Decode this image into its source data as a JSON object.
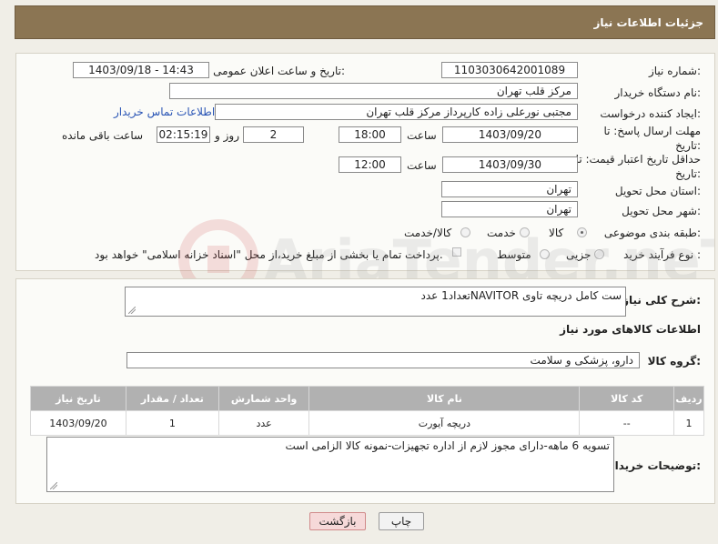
{
  "header": {
    "title": "جزئیات اطلاعات نیاز"
  },
  "form": {
    "need_number_label": "شماره نیاز:",
    "need_number": "1103030642001089",
    "announce_label": "تاریخ و ساعت اعلان عمومی:",
    "announce_value": "1403/09/18 - 14:43",
    "buyer_org_label": "نام دستگاه خریدار:",
    "buyer_org": "مرکز قلب تهران",
    "creator_label": "ایجاد کننده درخواست:",
    "creator": "مجتبی نورعلی زاده کارپرداز مرکز قلب تهران",
    "contact_link": "اطلاعات تماس خریدار",
    "reply_deadline_label": "مهلت ارسال پاسخ: تا تاریخ:",
    "reply_date": "1403/09/20",
    "time_label": "ساعت",
    "reply_time": "18:00",
    "days_value": "2",
    "days_label": "روز و",
    "remaining_time": "02:15:19",
    "remaining_label": "ساعت باقی مانده",
    "price_validity_label": "حداقل تاریخ اعتبار قیمت: تا تاریخ:",
    "price_date": "1403/09/30",
    "price_time": "12:00",
    "province_label": "استان محل تحویل:",
    "province": "تهران",
    "city_label": "شهر محل تحویل:",
    "city": "تهران",
    "category_label": "طبقه بندی موضوعی:",
    "category_options": [
      "کالا",
      "خدمت",
      "کالا/خدمت"
    ],
    "purchase_type_label": "نوع فرآیند خرید :",
    "purchase_options": [
      "جزیی",
      "متوسط"
    ],
    "payment_note": "پرداخت تمام یا بخشی از مبلغ خرید،از محل \"اسناد خزانه اسلامی\" خواهد بود."
  },
  "description": {
    "label": "شرح کلی نیاز:",
    "text": "ست کامل دریچه تاوی NAVITORتعداد1 عدد"
  },
  "goods_info": {
    "title": "اطلاعات کالاهای مورد نیاز",
    "group_label": "گروه کالا:",
    "group_value": "دارو، پزشکی و سلامت"
  },
  "items_table": {
    "columns": [
      "ردیف",
      "کد کالا",
      "نام کالا",
      "واحد شمارش",
      "تعداد / مقدار",
      "تاریخ نیاز"
    ],
    "rows": [
      [
        "1",
        "--",
        "دریچه آیورت",
        "عدد",
        "1",
        "1403/09/20"
      ]
    ]
  },
  "buyer_notes": {
    "label": "توضیحات خریدار:",
    "text": "تسویه 6 ماهه-دارای مجوز لازم از اداره تجهیزات-نمونه کالا الزامی است"
  },
  "buttons": {
    "print": "چاپ",
    "back": "بازگشت"
  },
  "watermark_text": "AriaTender.neT",
  "colors": {
    "header_bg": "#8b7553",
    "table_header_bg": "#b1b1b1",
    "link": "#2a55b5",
    "back_button_bg": "#f6d9d9"
  }
}
